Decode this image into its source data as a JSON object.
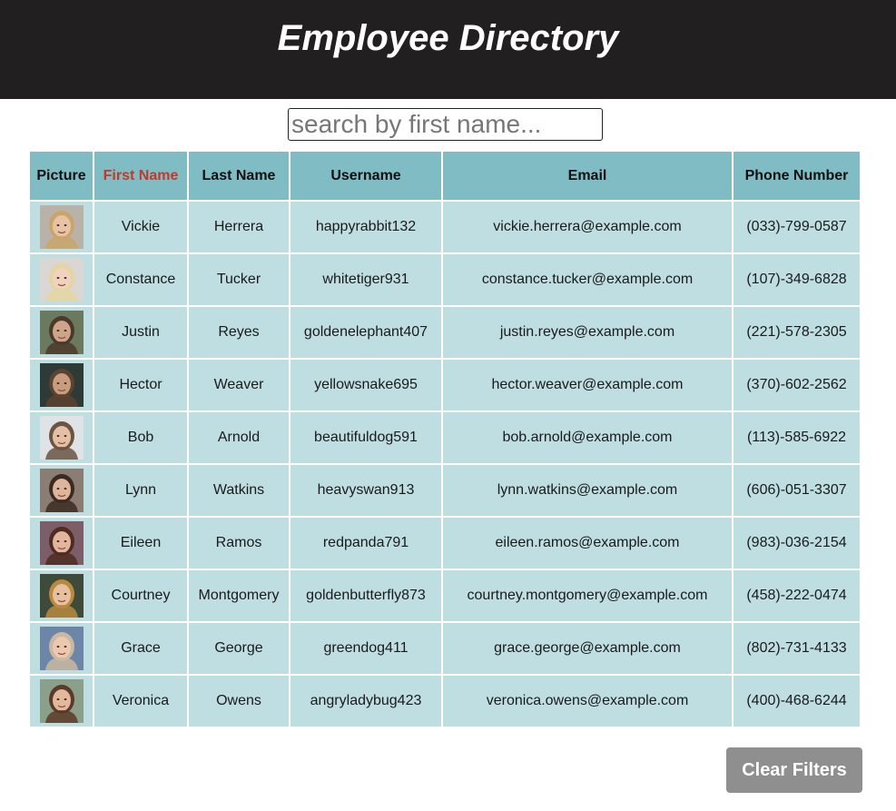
{
  "header": {
    "title": "Employee Directory"
  },
  "search": {
    "placeholder": "search by first name...",
    "value": ""
  },
  "table": {
    "columns": [
      "Picture",
      "First Name",
      "Last Name",
      "Username",
      "Email",
      "Phone Number"
    ],
    "sorted_column": "First Name",
    "sorted_color": "#c0392b",
    "rows": [
      {
        "first": "Vickie",
        "last": "Herrera",
        "username": "happyrabbit132",
        "email": "vickie.herrera@example.com",
        "phone": "(033)-799-0587",
        "skin": "#e9c2a6",
        "hair": "#c9a56a",
        "bg": "#b9b2a8"
      },
      {
        "first": "Constance",
        "last": "Tucker",
        "username": "whitetiger931",
        "email": "constance.tucker@example.com",
        "phone": "(107)-349-6828",
        "skin": "#f0d2bd",
        "hair": "#e4d6a2",
        "bg": "#d9d6d3"
      },
      {
        "first": "Justin",
        "last": "Reyes",
        "username": "goldenelephant407",
        "email": "justin.reyes@example.com",
        "phone": "(221)-578-2305",
        "skin": "#cfa58a",
        "hair": "#4a3a2a",
        "bg": "#6b7a5e"
      },
      {
        "first": "Hector",
        "last": "Weaver",
        "username": "yellowsnake695",
        "email": "hector.weaver@example.com",
        "phone": "(370)-602-2562",
        "skin": "#c89c7e",
        "hair": "#5a4330",
        "bg": "#2e3a36"
      },
      {
        "first": "Bob",
        "last": "Arnold",
        "username": "beautifuldog591",
        "email": "bob.arnold@example.com",
        "phone": "(113)-585-6922",
        "skin": "#e4bfa4",
        "hair": "#6a5543",
        "bg": "#dfe3e6"
      },
      {
        "first": "Lynn",
        "last": "Watkins",
        "username": "heavyswan913",
        "email": "lynn.watkins@example.com",
        "phone": "(606)-051-3307",
        "skin": "#deb49a",
        "hair": "#3b2a21",
        "bg": "#8a7d74"
      },
      {
        "first": "Eileen",
        "last": "Ramos",
        "username": "redpanda791",
        "email": "eileen.ramos@example.com",
        "phone": "(983)-036-2154",
        "skin": "#e2b59c",
        "hair": "#4e2c22",
        "bg": "#7d5e68"
      },
      {
        "first": "Courtney",
        "last": "Montgomery",
        "username": "goldenbutterfly873",
        "email": "courtney.montgomery@example.com",
        "phone": "(458)-222-0474",
        "skin": "#e7c09f",
        "hair": "#b8893f",
        "bg": "#3f4b3a"
      },
      {
        "first": "Grace",
        "last": "George",
        "username": "greendog411",
        "email": "grace.george@example.com",
        "phone": "(802)-731-4133",
        "skin": "#ecc8b0",
        "hair": "#c9b9a2",
        "bg": "#6d86a8"
      },
      {
        "first": "Veronica",
        "last": "Owens",
        "username": "angryladybug423",
        "email": "veronica.owens@example.com",
        "phone": "(400)-468-6244",
        "skin": "#e3b99d",
        "hair": "#5b3b28",
        "bg": "#8aa08a"
      }
    ]
  },
  "actions": {
    "clear_label": "Clear Filters"
  }
}
